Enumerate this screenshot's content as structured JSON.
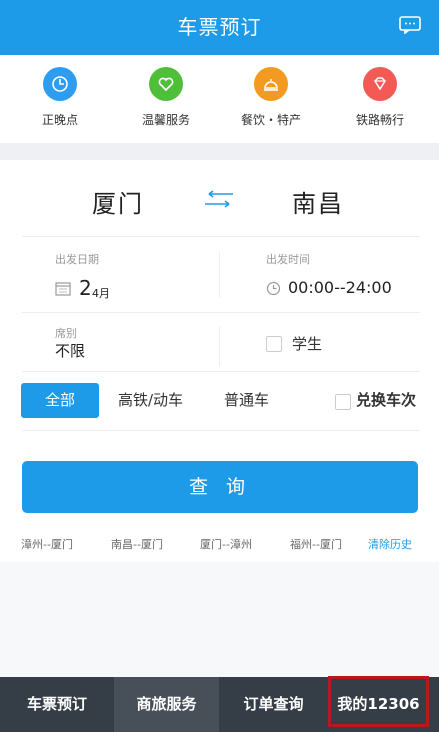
{
  "header": {
    "title": "车票预订",
    "message_icon": "message-icon"
  },
  "quick_links": [
    {
      "label": "正晚点",
      "icon": "clock-icon",
      "color": "#2e9df0"
    },
    {
      "label": "温馨服务",
      "icon": "heart-icon",
      "color": "#4fbf3a"
    },
    {
      "label": "餐饮・特产",
      "icon": "food-icon",
      "color": "#f39a22"
    },
    {
      "label": "铁路畅行",
      "icon": "diamond-icon",
      "color": "#f35a55"
    }
  ],
  "trip": {
    "from": "厦门",
    "to": "南昌",
    "date_label": "出发日期",
    "date_day": "2",
    "date_month": "4月",
    "time_label": "出发时间",
    "time_value": "00:00--24:00",
    "seat_label": "席别",
    "seat_value": "不限",
    "student_label": "学生"
  },
  "train_types": {
    "all": "全部",
    "gd": "高铁/动车",
    "normal": "普通车",
    "exchange": "兑换车次"
  },
  "query_button": "查 询",
  "history": [
    "漳州--厦门",
    "南昌--厦门",
    "厦门--漳州",
    "福州--厦门"
  ],
  "clear_history": "清除历史",
  "bottom_nav": [
    "车票预订",
    "商旅服务",
    "订单查询",
    "我的12306"
  ],
  "colors": {
    "brand_blue": "#1e9be8",
    "nav_dark": "#353d46",
    "highlight_red": "#b8191f"
  }
}
